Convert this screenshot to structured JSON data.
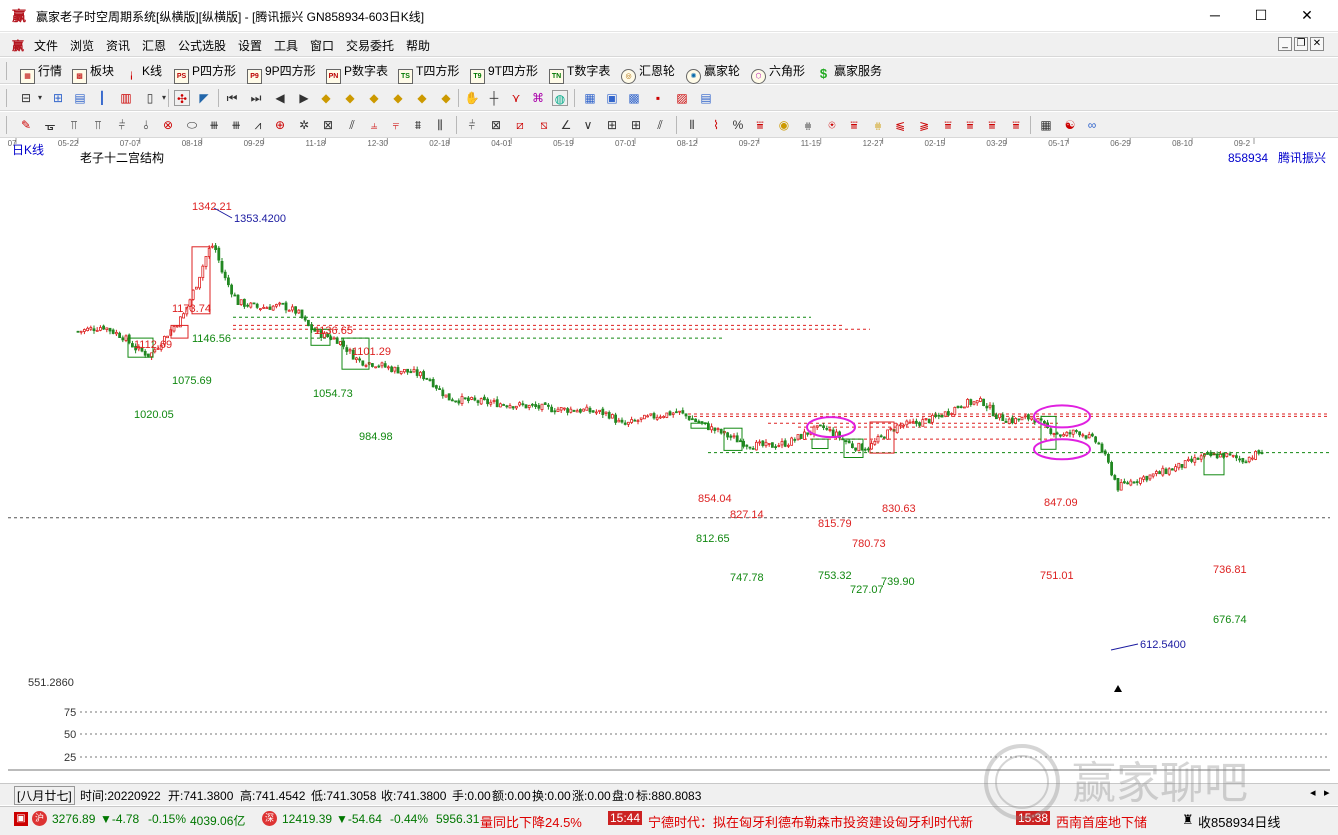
{
  "window": {
    "title": "赢家老子时空周期系统[纵横版][纵横版] - [腾讯振兴  GN858934-603日K线]",
    "minimize": "─",
    "maximize": "☐",
    "close": "✕"
  },
  "menu": [
    "文件",
    "浏览",
    "资讯",
    "汇恩",
    "公式选股",
    "设置",
    "工具",
    "窗口",
    "交易委托",
    "帮助"
  ],
  "toolbar1": [
    "行情",
    "板块",
    "K线",
    "P四方形",
    "9P四方形",
    "P数字表",
    "T四方形",
    "9T四方形",
    "T数字表",
    "汇恩轮",
    "赢家轮",
    "六角形",
    "赢家服务"
  ],
  "toolbar1_icons": [
    "table-icon",
    "blocks-icon",
    "candles-icon",
    "PS",
    "P9",
    "PN",
    "TS",
    "T9",
    "TN",
    "ring-icon",
    "wheel-icon",
    "hexagon-icon",
    "dollar-icon"
  ],
  "chart": {
    "period_label": "日K线",
    "indicator_title": "老子十二宫结构",
    "code": "858934",
    "name": "腾讯振兴",
    "date_axis": [
      "04-07",
      "05-22",
      "07-07",
      "08-18",
      "09-29",
      "11-18",
      "12-30",
      "02-18",
      "04-01",
      "05-19",
      "07-01",
      "08-12",
      "09-27",
      "11-15",
      "12-27",
      "02-15",
      "03-29",
      "05-17",
      "06-29",
      "08-10",
      "09-2"
    ],
    "bottom_axis_label": "551.2860",
    "y_ticks": [
      "75",
      "50",
      "25"
    ],
    "price_labels": [
      "1342.21",
      "1353.4200",
      "1173.74",
      "1146.56",
      "1112.69",
      "1075.69",
      "1020.05",
      "1136.65",
      "1101.29",
      "1054.73",
      "984.98",
      "854.04",
      "827.14",
      "812.65",
      "747.78",
      "815.79",
      "780.73",
      "753.32",
      "830.63",
      "727.07",
      "739.90",
      "847.09",
      "751.01",
      "736.81",
      "676.74",
      "612.5400"
    ]
  },
  "status": {
    "lunar": "[八月廿七]",
    "time_label": "时间:",
    "time": "20220922",
    "open_label": "开:",
    "open": "741.3800",
    "high_label": "高:",
    "high": "741.4542",
    "low_label": "低:",
    "low": "741.3058",
    "close_label": "收:",
    "close": "741.3800",
    "hand_label": "手:",
    "hand": "0.00",
    "amount_label": "额:",
    "amount": "0.00",
    "turnover_label": "换:",
    "turnover": "0.00",
    "change_label": "涨:",
    "change": "0.00",
    "pan_label": "盘:",
    "pan": "0",
    "mark_label": "标:",
    "mark": "880.8083"
  },
  "ticker": {
    "sh_value": "3276.89",
    "sh_change": "▼-4.78",
    "sh_pct": "-0.15%",
    "sh_amount": "4039.06亿",
    "sz_value": "12419.39",
    "sz_change": "▼-54.64",
    "sz_pct": "-0.44%",
    "sz_amount": "5956.31",
    "news1": "量同比下降24.5%",
    "news2_time": "15:44",
    "news2": "宁德时代：拟在匈牙利德布勒森市投资建设匈牙利时代新",
    "news3_time": "15:38",
    "news3": "西南首座地下储",
    "right_label": "收858934日线"
  },
  "watermark": "赢家聊吧",
  "colors": {
    "up": "#dd2222",
    "down": "#228822",
    "box_red": "#dd2222",
    "box_green": "#118811",
    "ellipse": "#e020e0",
    "label_blue": "#1a1aa0"
  }
}
